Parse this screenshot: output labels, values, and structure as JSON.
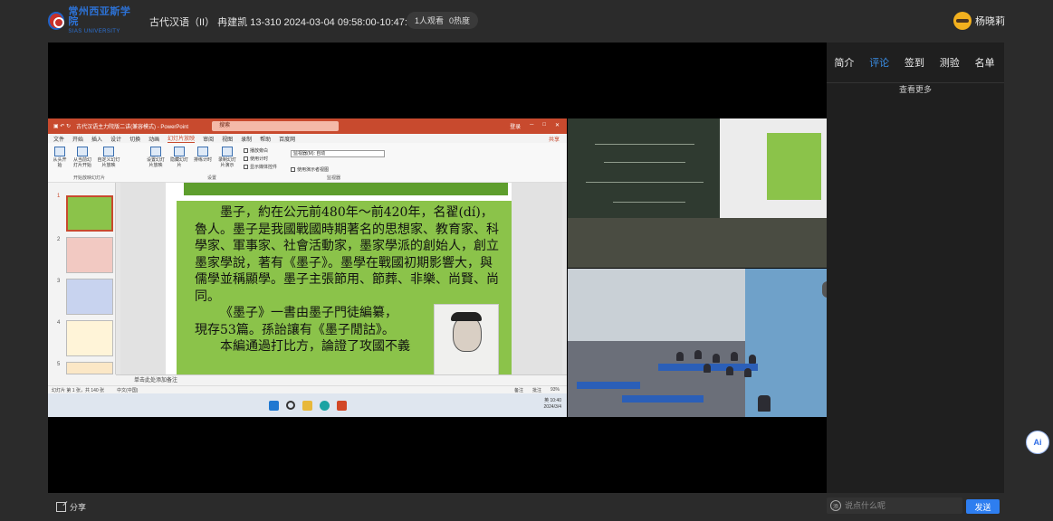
{
  "header": {
    "logo_cn": "常州西亚斯学院",
    "logo_en": "SIAS UNIVERSITY",
    "course_title": "古代汉语（II） 冉建凯 13-310 2024-03-04 09:58:00-10:47:00",
    "viewers": "1人观看",
    "heat": "0热度",
    "user_name": "杨晓莉"
  },
  "powerpoint": {
    "title": "古代汉语主力院版二讲(兼容模式) - PowerPoint",
    "search": "搜索",
    "window_controls": [
      "登录",
      "─",
      "□",
      "✕"
    ],
    "menu": [
      "文件",
      "开始",
      "插入",
      "设计",
      "切换",
      "动画",
      "幻灯片放映",
      "审阅",
      "视图",
      "录制",
      "帮助",
      "百度网"
    ],
    "menu_active": "幻灯片放映",
    "share": "共享",
    "ribbon_buttons": [
      "从头开始",
      "从当前幻灯片开始",
      "自定义幻灯片放映",
      "设置幻灯片放映",
      "隐藏幻灯片",
      "排练计时",
      "录制幻灯片演示"
    ],
    "ribbon_checks": [
      "播放旁白",
      "使用计时",
      "显示媒体控件"
    ],
    "ribbon_group_labels": [
      "开始放映幻灯片",
      "设置",
      "监视器"
    ],
    "monitor_label": "监视器(M): 自动",
    "presenter_view": "使用演示者视图",
    "thumb_numbers": [
      "1",
      "2",
      "3",
      "4",
      "5"
    ],
    "slide_paragraphs": [
      "墨子，約在公元前480年～前420年，名翟(dí)，魯人。墨子是我國戰國時期著名的思想家、教育家、科學家、軍事家、社會活動家，墨家學派的創始人，創立墨家學說，著有《墨子》。墨學在戰國初期影響大，與儒學並稱顯學。墨子主張節用、節葬、非樂、尚賢、尚同。",
      "《墨子》一書由墨子門徒編纂，",
      "現存53篇。孫詒讓有《墨子閒詁》。",
      "本編通過打比方，論證了攻國不義"
    ],
    "notes_placeholder": "单击此处添加备注",
    "status_left": "幻灯片 第 1 张，共 140 张",
    "status_lang": "中文(中国)",
    "status_right": [
      "备注",
      "批注",
      "93%"
    ],
    "clock_time": "10:40",
    "clock_date": "2024/3/4",
    "tray_text": "英"
  },
  "side_panel": {
    "tabs": [
      "简介",
      "评论",
      "签到",
      "测验",
      "名单"
    ],
    "active_tab": "评论",
    "see_more": "查看更多"
  },
  "bottom": {
    "share_label": "分享",
    "comment_placeholder": "说点什么呢",
    "send_label": "发送",
    "emoji_label": "添"
  },
  "ai_button": "Ai",
  "colors": {
    "accent": "#2e7ef0",
    "tab_active": "#3a8ee6",
    "ppt_red": "#c84a2e",
    "slide_green": "#8bc34a"
  }
}
